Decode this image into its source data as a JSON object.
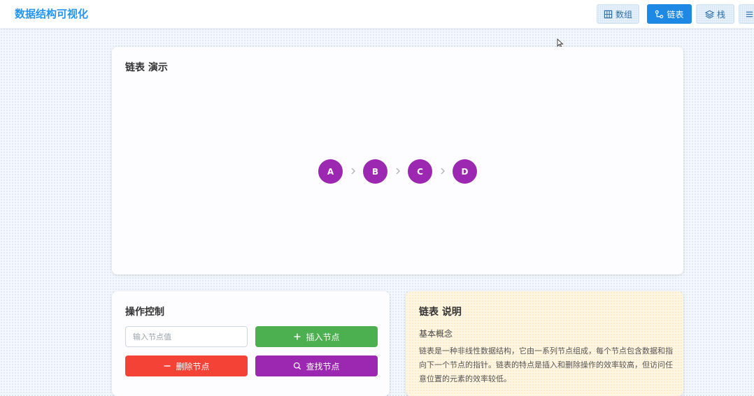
{
  "header": {
    "brand": "数据结构可视化",
    "nav": [
      {
        "label": "数组",
        "icon": "grid-icon",
        "active": false
      },
      {
        "label": "链表",
        "icon": "link-icon",
        "active": true
      },
      {
        "label": "栈",
        "icon": "layers-icon",
        "active": false
      },
      {
        "label": "",
        "icon": "list-icon",
        "active": false
      }
    ]
  },
  "visualization": {
    "title": "链表 演示",
    "nodes": [
      "A",
      "B",
      "C",
      "D"
    ],
    "node_color": "#9c27b0",
    "arrow_icon": "chevron-right-icon"
  },
  "controls": {
    "title": "操作控制",
    "input": {
      "value": "",
      "placeholder": "输入节点值"
    },
    "insert_label": "插入节点",
    "delete_label": "删除节点",
    "find_label": "查找节点",
    "colors": {
      "insert": "#4caf50",
      "delete": "#f44336",
      "find": "#9c27b0"
    }
  },
  "info": {
    "title": "链表 说明",
    "subtitle": "基本概念",
    "text": "链表是一种非线性数据结构，它由一系列节点组成，每个节点包含数据和指向下一个节点的指针。链表的特点是插入和删除操作的效率较高，但访问任意位置的元素的效率较低。"
  },
  "colors": {
    "accent": "#2196f3",
    "active_nav": "#1e88e5"
  }
}
